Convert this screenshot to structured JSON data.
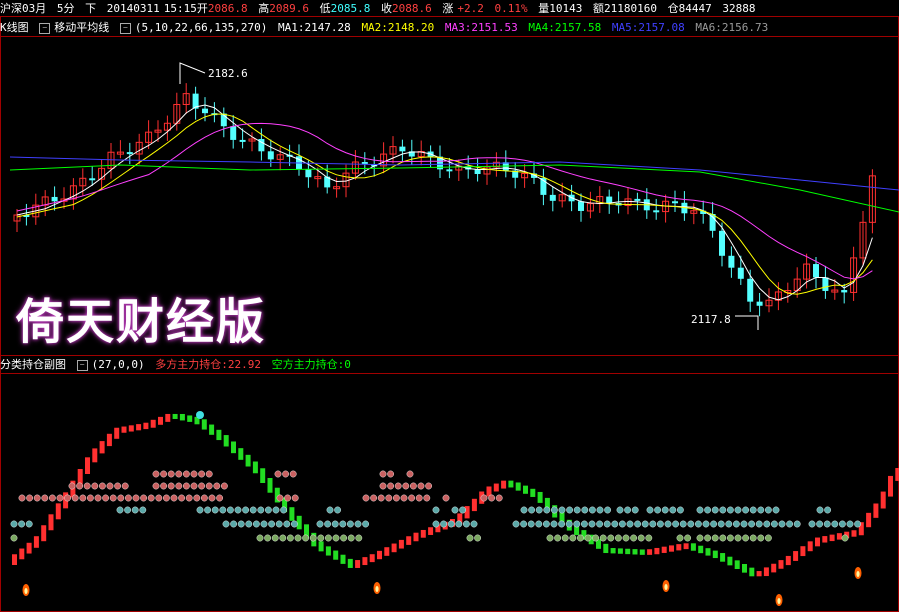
{
  "infobar": {
    "symbol": "沪深03月",
    "period": "5分",
    "direction": "下",
    "date": "20140311",
    "time": "15:15开",
    "open": "2086.8",
    "high_label": "高",
    "high": "2089.6",
    "low_label": "低",
    "low": "2085.8",
    "close_label": "收",
    "close": "2088.6",
    "change_label": "涨",
    "change": "+2.2",
    "pct": "0.11%",
    "vol_label": "量",
    "volume": "10143",
    "amount_label": "额",
    "amount": "21180160",
    "pos_label": "仓",
    "position": "84447",
    "extra": "32888"
  },
  "ma_bar": {
    "kline_label": "K线图",
    "ma_label": "移动平均线",
    "params": "(5,10,22,66,135,270)",
    "ma1": "MA1:2147.28",
    "ma2": "MA2:2148.20",
    "ma3": "MA3:2151.53",
    "ma4": "MA4:2157.58",
    "ma5": "MA5:2157.08",
    "ma6": "MA6:2156.73"
  },
  "price_labels": {
    "high": "2182.6",
    "low": "2117.8"
  },
  "watermark": "倚天财经版",
  "sub_bar": {
    "title": "分类持仓副图",
    "params": "(27,0,0)",
    "long_label": "多方主力持仓:22.92",
    "short_label": "空方主力持仓:0"
  },
  "colors": {
    "up": "#ff3030",
    "down": "#54ffff",
    "ma1": "#ffffff",
    "ma2": "#ffff00",
    "ma3": "#ff40ff",
    "ma4": "#00ff00",
    "ma5": "#4040ff",
    "ma6": "#9a9a9a",
    "frame": "#a00000"
  },
  "icons": [
    "minus-box-icon",
    "flame-marker-icon",
    "smiley-icon"
  ]
}
